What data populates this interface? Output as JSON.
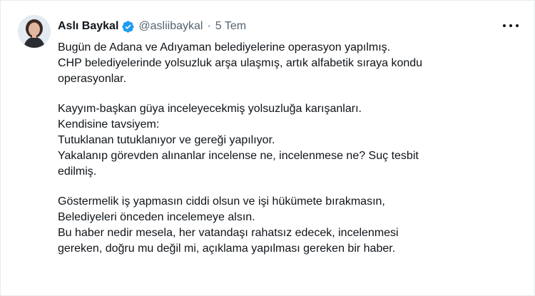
{
  "tweet": {
    "author_name": "Aslı Baykal",
    "handle": "@asliibaykal",
    "separator": "·",
    "time": "5 Tem",
    "lines_p1": [
      "Bugün de Adana ve Adıyaman belediyelerine operasyon yapılmış.",
      "CHP belediyelerinde yolsuzluk arşa ulaşmış, artık alfabetik sıraya kondu",
      "operasyonlar."
    ],
    "lines_p2": [
      "Kayyım-başkan güya inceleyecekmiş yolsuzluğa karışanları.",
      "Kendisine tavsiyem:",
      "Tutuklanan tutuklanıyor ve gereği yapılıyor.",
      "Yakalanıp görevden alınanlar incelense ne, incelenmese ne? Suç tesbit",
      "edilmiş."
    ],
    "lines_p3": [
      "Göstermelik iş yapmasın ciddi olsun ve işi hükümete bırakmasın,",
      "Belediyeleri önceden incelemeye alsın.",
      "Bu haber nedir mesela, her vatandaşı rahatsız edecek, incelenmesi",
      "gereken, doğru mu değil mi,  açıklama yapılması gereken bir haber."
    ]
  },
  "icons": {
    "avatar": "avatar-photo",
    "verified": "verified-badge-icon",
    "more": "more-options-icon"
  },
  "colors": {
    "text": "#0f1419",
    "secondary": "#536471",
    "verified": "#1d9bf0"
  }
}
